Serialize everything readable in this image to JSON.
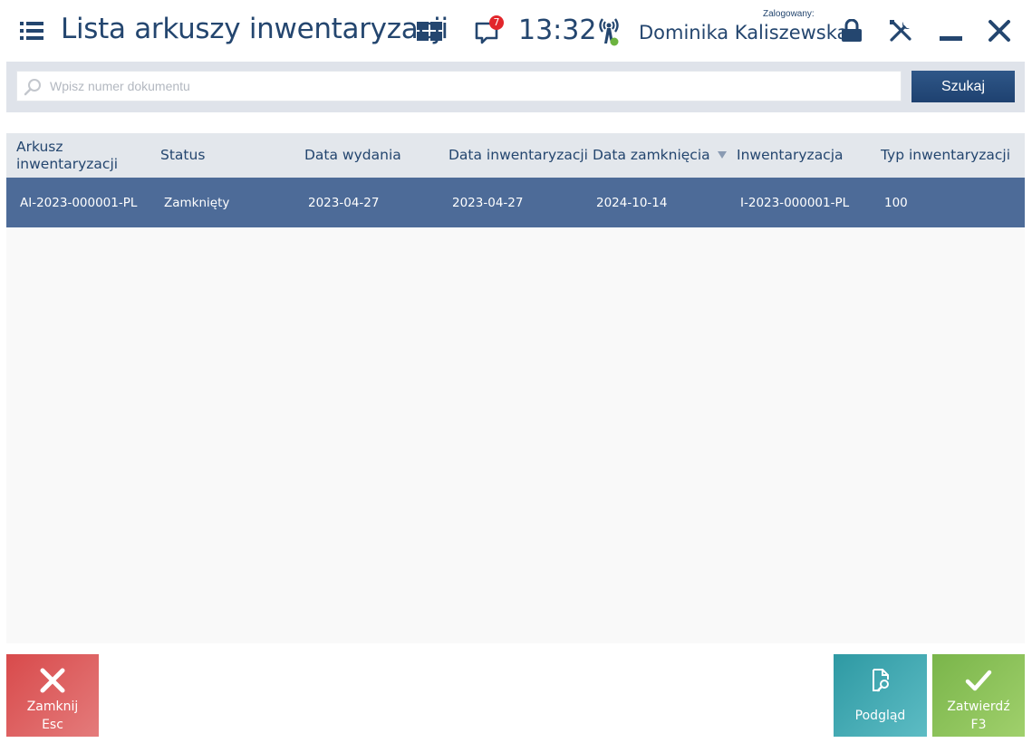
{
  "header": {
    "title": "Lista arkuszy inwentaryzacji",
    "notification_count": "7",
    "time": "13:32",
    "logged_label": "Zalogowany:",
    "user_name": "Dominika Kaliszewska"
  },
  "search": {
    "placeholder": "Wpisz numer dokumentu",
    "value": "",
    "button_label": "Szukaj"
  },
  "table": {
    "columns": [
      "Arkusz inwentaryzacji",
      "Status",
      "Data wydania",
      "Data inwentaryzacji",
      "Data zamknięcia",
      "Inwentaryzacja",
      "Typ inwentaryzacji"
    ],
    "sorted_column": "Data zamknięcia",
    "sort_direction": "descending",
    "rows": [
      [
        "AI-2023-000001-PL",
        "Zamknięty",
        "2023-04-27",
        "2023-04-27",
        "2024-10-14",
        "I-2023-000001-PL",
        "100"
      ]
    ]
  },
  "footer": {
    "close_label": "Zamknij",
    "close_shortcut": "Esc",
    "preview_label": "Podgląd",
    "confirm_label": "Zatwierdź",
    "confirm_shortcut": "F3"
  },
  "colors": {
    "primary": "#24466f",
    "selected_row": "#4d6b98",
    "close_button": "#d84a4b",
    "preview_button": "#2e99a3",
    "confirm_button": "#7ab54a",
    "badge": "#e2262b",
    "online_dot": "#6cb33f"
  },
  "icons": [
    "menu-icon",
    "tiles-icon",
    "chat-icon",
    "antenna-icon",
    "lock-icon",
    "tools-icon",
    "minimize-icon",
    "close-icon",
    "search-icon",
    "sort-down-icon",
    "x-icon",
    "document-search-icon",
    "checkmark-icon"
  ]
}
